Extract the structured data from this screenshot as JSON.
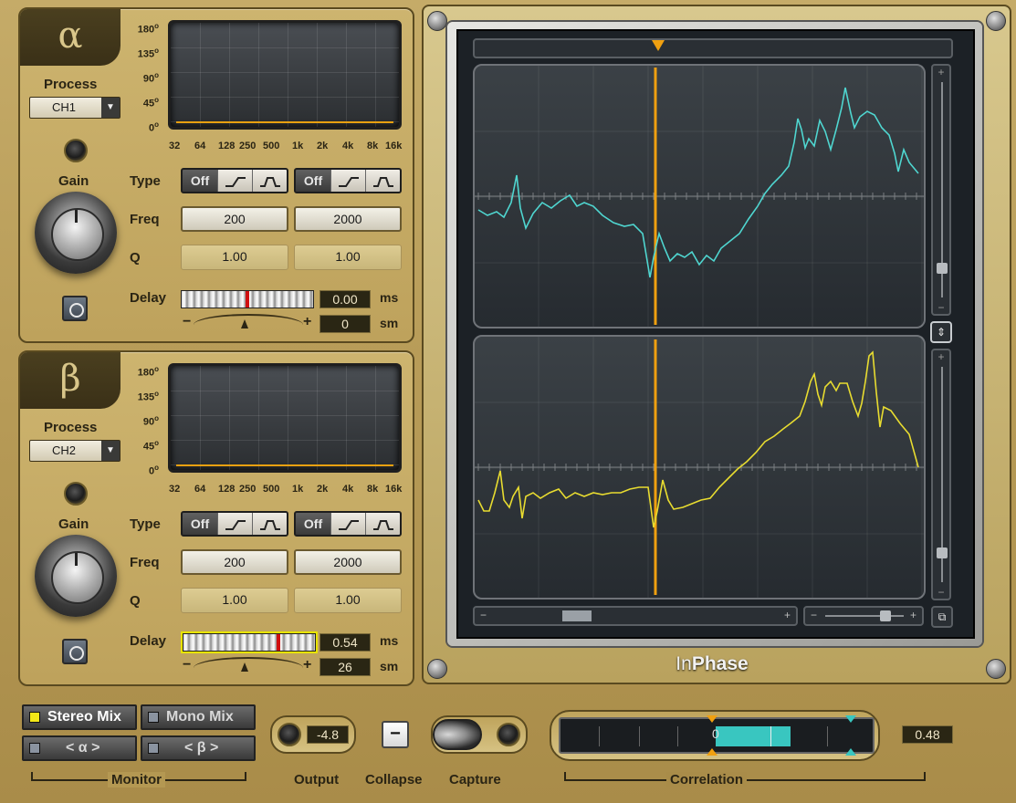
{
  "alpha": {
    "symbol": "α",
    "process_label": "Process",
    "process_value": "CH1",
    "gain_label": "Gain",
    "type_label": "Type",
    "freq_label": "Freq",
    "q_label": "Q",
    "delay_label": "Delay",
    "deg_labels": [
      "180",
      "135",
      "90",
      "45",
      "0"
    ],
    "hz_labels": [
      "32",
      "64",
      "128",
      "250",
      "500",
      "1k",
      "2k",
      "4k",
      "8k",
      "16k"
    ],
    "filter1": {
      "off": "Off",
      "freq": "200",
      "q": "1.00"
    },
    "filter2": {
      "off": "Off",
      "freq": "2000",
      "q": "1.00"
    },
    "delay_ms": "0.00",
    "delay_sm": "0",
    "ms_unit": "ms",
    "sm_unit": "sm",
    "minus": "−",
    "plus": "+"
  },
  "beta": {
    "symbol": "β",
    "process_label": "Process",
    "process_value": "CH2",
    "gain_label": "Gain",
    "type_label": "Type",
    "freq_label": "Freq",
    "q_label": "Q",
    "delay_label": "Delay",
    "deg_labels": [
      "180",
      "135",
      "90",
      "45",
      "0"
    ],
    "hz_labels": [
      "32",
      "64",
      "128",
      "250",
      "500",
      "1k",
      "2k",
      "4k",
      "8k",
      "16k"
    ],
    "filter1": {
      "off": "Off",
      "freq": "200",
      "q": "1.00"
    },
    "filter2": {
      "off": "Off",
      "freq": "2000",
      "q": "1.00"
    },
    "delay_ms": "0.54",
    "delay_sm": "26",
    "ms_unit": "ms",
    "sm_unit": "sm",
    "minus": "−",
    "plus": "+"
  },
  "display": {
    "brand_in": "In",
    "brand_phase": "Phase",
    "colors": {
      "alpha_wave": "#4fd6d0",
      "beta_wave": "#e8dc30",
      "cursor": "#f0a010"
    }
  },
  "monitor": {
    "stereo_mix": "Stereo Mix",
    "mono_mix": "Mono Mix",
    "alpha_solo": "< α >",
    "beta_solo": "< β >",
    "label": "Monitor"
  },
  "output": {
    "label": "Output",
    "value": "-4.8"
  },
  "collapse": {
    "label": "Collapse",
    "glyph": "−"
  },
  "capture": {
    "label": "Capture"
  },
  "correlation": {
    "label": "Correlation",
    "value": "0.48",
    "zero_mark": "0"
  }
}
